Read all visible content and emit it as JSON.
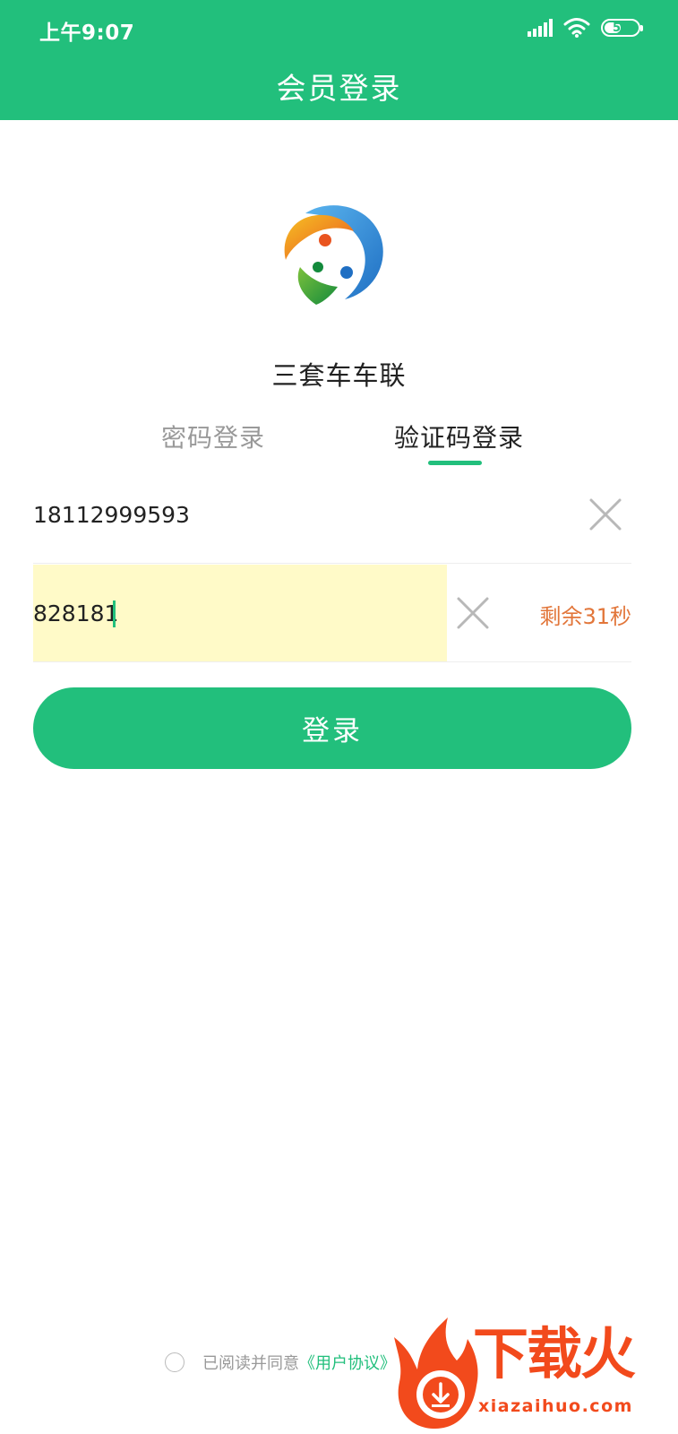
{
  "status_bar": {
    "time": "上午9:07",
    "battery_level": "50"
  },
  "header": {
    "title": "会员登录"
  },
  "app": {
    "name": "三套车车联"
  },
  "tabs": [
    {
      "label": "密码登录",
      "active": false
    },
    {
      "label": "验证码登录",
      "active": true
    }
  ],
  "form": {
    "phone_value": "18112999593",
    "code_value": "828181",
    "countdown": "剩余31秒",
    "login_label": "登录"
  },
  "agreement": {
    "text": "已阅读并同意",
    "link": "《用户协议》",
    "checked": false
  },
  "watermark": {
    "name": "下载火",
    "url": "xiazaihuo.com"
  },
  "colors": {
    "brand": "#22bf7c",
    "countdown": "#e2763a",
    "autofill": "#fffac8",
    "watermark": "#f24a1c"
  },
  "icons": [
    "signal-icon",
    "wifi-icon",
    "battery-icon",
    "app-logo-icon",
    "clear-icon",
    "circle-checkbox-icon",
    "watermark-logo-icon"
  ]
}
